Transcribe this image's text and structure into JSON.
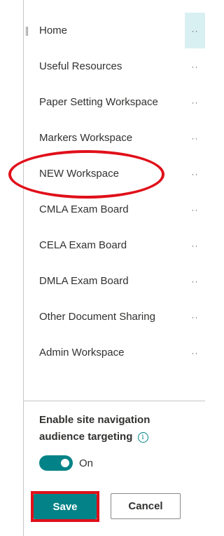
{
  "nav": {
    "items": [
      {
        "label": "Home",
        "more": "··",
        "active": true
      },
      {
        "label": "Useful Resources",
        "more": "··"
      },
      {
        "label": "Paper Setting Workspace",
        "more": "··"
      },
      {
        "label": "Markers Workspace",
        "more": "··"
      },
      {
        "label": "NEW Workspace",
        "more": "··"
      },
      {
        "label": "CMLA Exam Board",
        "more": "··"
      },
      {
        "label": "CELA Exam Board",
        "more": "··"
      },
      {
        "label": "DMLA Exam Board",
        "more": "··"
      },
      {
        "label": "Other Document Sharing",
        "more": "··"
      },
      {
        "label": "Admin Workspace",
        "more": "··"
      }
    ]
  },
  "targeting": {
    "label": "Enable site navigation audience targeting",
    "info_icon": "i",
    "toggle_state": "On",
    "toggle_on": true
  },
  "actions": {
    "save_label": "Save",
    "cancel_label": "Cancel"
  },
  "colors": {
    "accent": "#038387",
    "annotation": "#e0101a",
    "active_bg": "#d9f0f3"
  }
}
